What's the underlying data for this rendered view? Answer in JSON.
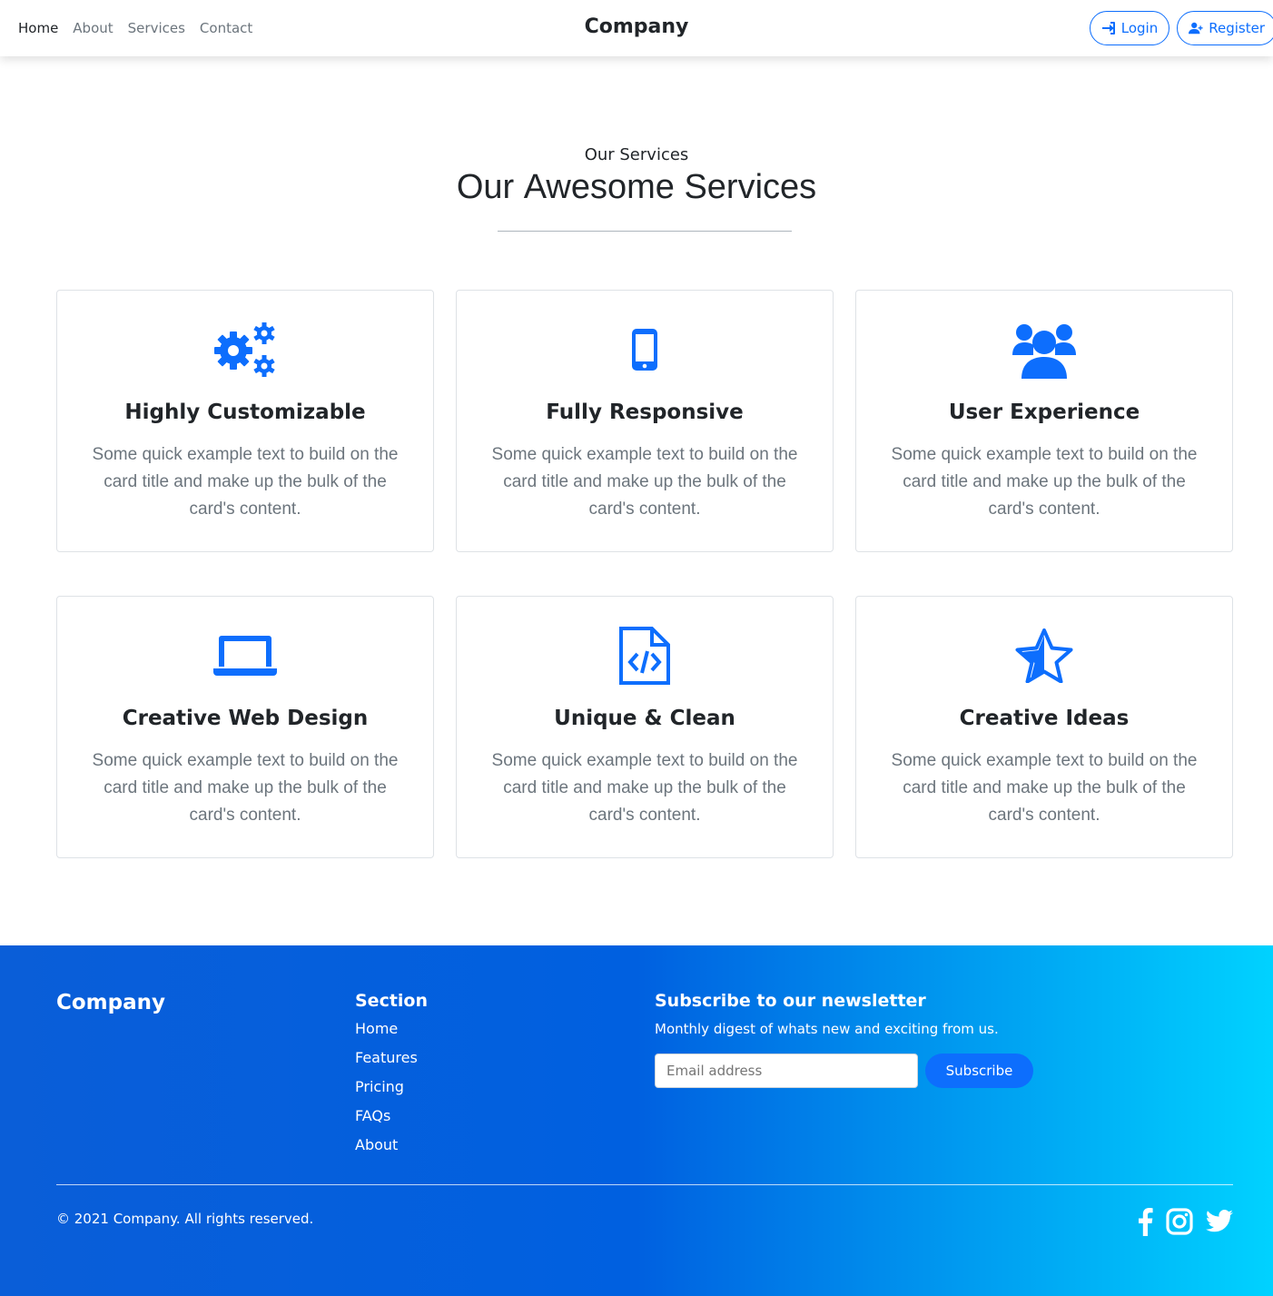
{
  "navbar": {
    "links": [
      "Home",
      "About",
      "Services",
      "Contact"
    ],
    "brand": "Company",
    "login_label": "Login",
    "register_label": "Register"
  },
  "heading": {
    "eyebrow": "Our Services",
    "title_pre": "Our ",
    "title_strong": "Awesome",
    "title_post": " Services"
  },
  "cards": [
    {
      "icon": "gears-icon",
      "title": "Highly Customizable",
      "text": "Some quick example text to build on the card title and make up the bulk of the card's content."
    },
    {
      "icon": "mobile-icon",
      "title": "Fully Responsive",
      "text": "Some quick example text to build on the card title and make up the bulk of the card's content."
    },
    {
      "icon": "users-icon",
      "title": "User Experience",
      "text": "Some quick example text to build on the card title and make up the bulk of the card's content."
    },
    {
      "icon": "laptop-icon",
      "title": "Creative Web Design",
      "text": "Some quick example text to build on the card title and make up the bulk of the card's content."
    },
    {
      "icon": "file-code-icon",
      "title": "Unique & Clean",
      "text": "Some quick example text to build on the card title and make up the bulk of the card's content."
    },
    {
      "icon": "star-icon",
      "title": "Creative Ideas",
      "text": "Some quick example text to build on the card title and make up the bulk of the card's content."
    }
  ],
  "footer": {
    "brand": "Company",
    "section_title": "Section",
    "links": [
      "Home",
      "Features",
      "Pricing",
      "FAQs",
      "About"
    ],
    "newsletter_title": "Subscribe to our newsletter",
    "newsletter_text": "Monthly digest of whats new and exciting from us.",
    "email_placeholder": "Email address",
    "subscribe_label": "Subscribe",
    "copyright": "© 2021 Company. All rights reserved.",
    "social": [
      "facebook-icon",
      "instagram-icon",
      "twitter-icon"
    ]
  },
  "colors": {
    "accent": "#0d6efd",
    "footer_gradient_start": "#0a5ed8",
    "footer_gradient_end": "#00d2ff"
  }
}
